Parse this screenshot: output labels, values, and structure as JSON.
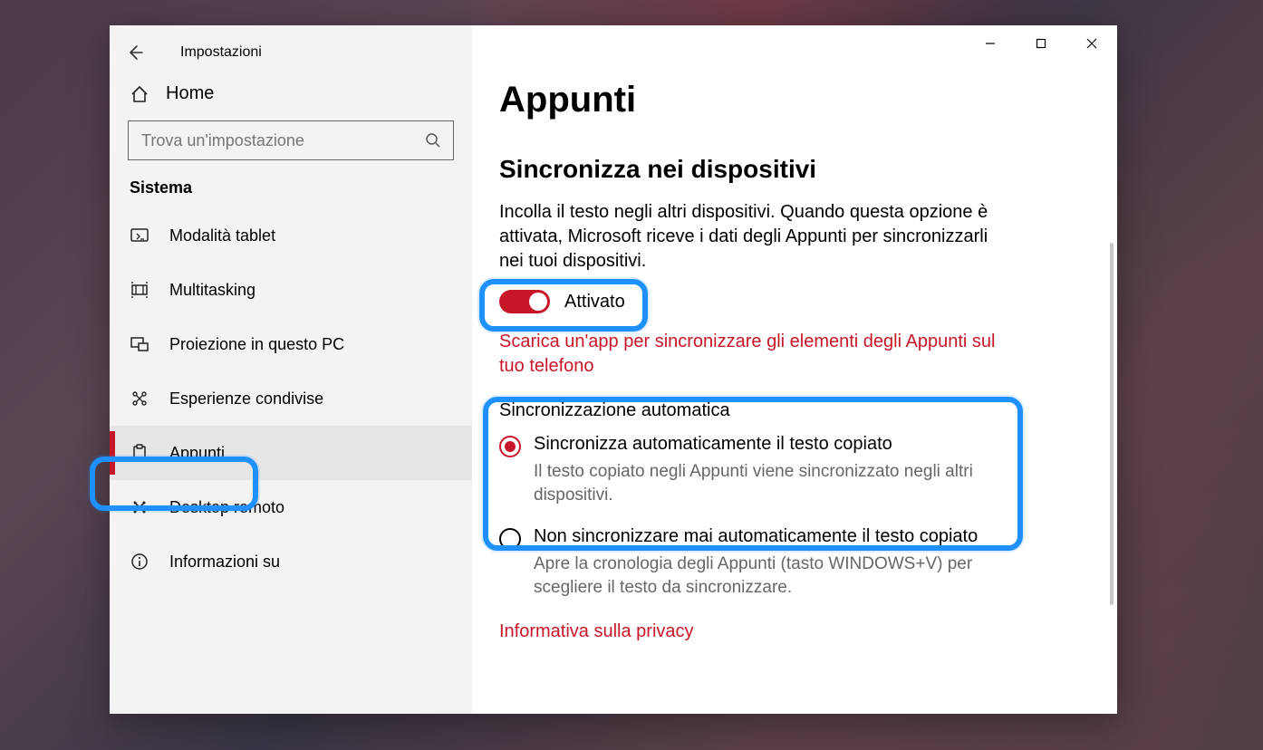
{
  "app_title": "Impostazioni",
  "home_label": "Home",
  "search_placeholder": "Trova un'impostazione",
  "category": "Sistema",
  "nav": [
    {
      "label": "Modalità tablet"
    },
    {
      "label": "Multitasking"
    },
    {
      "label": "Proiezione in questo PC"
    },
    {
      "label": "Esperienze condivise"
    },
    {
      "label": "Appunti"
    },
    {
      "label": "Desktop remoto"
    },
    {
      "label": "Informazioni su"
    }
  ],
  "page_title": "Appunti",
  "section_title": "Sincronizza nei dispositivi",
  "section_desc": "Incolla il testo negli altri dispositivi. Quando questa opzione è attivata, Microsoft riceve i dati degli Appunti per sincronizzarli nei tuoi dispositivi.",
  "toggle_state_label": "Attivato",
  "download_link": "Scarica un'app per sincronizzare gli elementi degli Appunti sul tuo telefono",
  "auto_sync_title": "Sincronizzazione automatica",
  "radio1_title": "Sincronizza automaticamente il testo copiato",
  "radio1_sub": "Il testo copiato negli Appunti viene sincronizzato negli altri dispositivi.",
  "radio2_title": "Non sincronizzare mai automaticamente il testo copiato",
  "radio2_sub": "Apre la cronologia degli Appunti (tasto WINDOWS+V) per scegliere il testo da sincronizzare.",
  "privacy_link": "Informativa sulla privacy"
}
